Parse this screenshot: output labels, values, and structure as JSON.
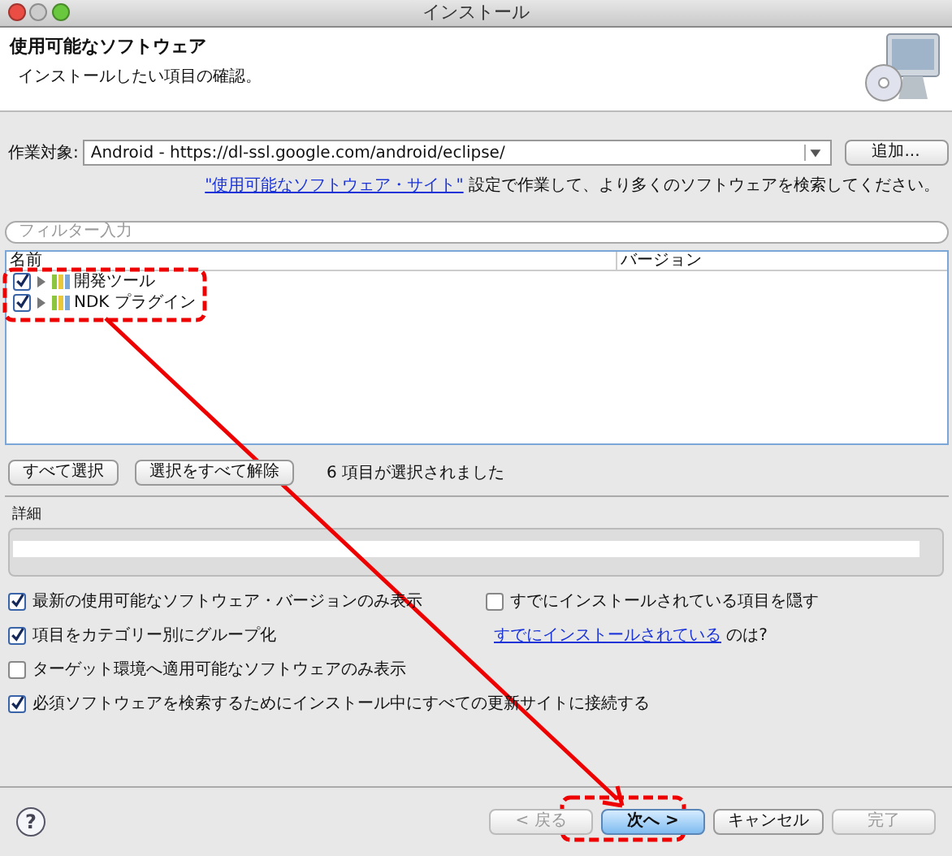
{
  "window": {
    "title": "インストール"
  },
  "header": {
    "title": "使用可能なソフトウェア",
    "subtitle": "インストールしたい項目の確認。"
  },
  "work_target": {
    "label": "作業対象:",
    "value": "Android - https://dl-ssl.google.com/android/eclipse/",
    "add_button": "追加..."
  },
  "site_note": {
    "link": "\"使用可能なソフトウェア・サイト\"",
    "rest": " 設定で作業して、より多くのソフトウェアを検索してください。"
  },
  "filter": {
    "placeholder": "フィルター入力"
  },
  "tree": {
    "columns": [
      "名前",
      "バージョン"
    ],
    "rows": [
      {
        "label": "開発ツール",
        "checked": true,
        "expanded": false
      },
      {
        "label": "NDK プラグイン",
        "checked": true,
        "expanded": false
      }
    ]
  },
  "select_buttons": [
    "すべて選択",
    "選択をすべて解除"
  ],
  "selection_count": "6 項目が選択されました",
  "details": {
    "label": "詳細"
  },
  "options": [
    {
      "label": "最新の使用可能なソフトウェア・バージョンのみ表示",
      "checked": true
    },
    {
      "label": "項目をカテゴリー別にグループ化",
      "checked": true
    },
    {
      "label": "ターゲット環境へ適用可能なソフトウェアのみ表示",
      "checked": false
    },
    {
      "label": "必須ソフトウェアを検索するためにインストール中にすべての更新サイトに接続する",
      "checked": true
    }
  ],
  "hide_installed": {
    "label": "すでにインストールされている項目を隠す",
    "checked": false
  },
  "installed_note": {
    "link": "すでにインストールされている",
    "rest": " のは?"
  },
  "buttons": [
    {
      "label": "< 戻る",
      "disabled": true,
      "default": false
    },
    {
      "label": "次へ >",
      "disabled": false,
      "default": true
    },
    {
      "label": "キャンセル",
      "disabled": false,
      "default": false
    },
    {
      "label": "完了",
      "disabled": true,
      "default": false
    }
  ],
  "help": "?"
}
